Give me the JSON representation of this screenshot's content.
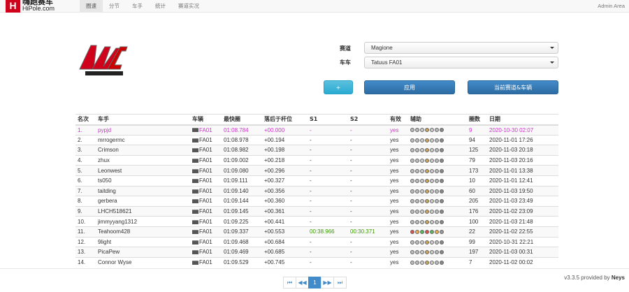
{
  "header": {
    "logo_cn": "嗨跑赛车",
    "logo_en": "HiPole.com",
    "logo_mark": "H",
    "nav": [
      "圈速",
      "分节",
      "车手",
      "统计",
      "赛道实况"
    ],
    "admin": "Admin Area"
  },
  "filters": {
    "track_label": "赛道",
    "track_value": "Magione",
    "car_label": "车车",
    "car_value": "Tatuus FA01",
    "plus_label": "+",
    "apply_label": "应用",
    "current_label": "当前赛道&车辆"
  },
  "table": {
    "headers": [
      "名次",
      "车手",
      "车辆",
      "最快圈",
      "落后于杆位",
      "S1",
      "S2",
      "有效",
      "辅助",
      "圈数",
      "日期"
    ],
    "rows": [
      {
        "rank": "1.",
        "driver": "pypjd",
        "car": "FA01",
        "best": "01:08.784",
        "gap": "+00.000",
        "s1": "-",
        "s2": "-",
        "valid": "yes",
        "laps": "9",
        "date": "2020-10-30 02:07"
      },
      {
        "rank": "2.",
        "driver": "mrrogermc",
        "car": "FA01",
        "best": "01:08.978",
        "gap": "+00.194",
        "s1": "-",
        "s2": "-",
        "valid": "yes",
        "laps": "94",
        "date": "2020-11-01 17:26"
      },
      {
        "rank": "3.",
        "driver": "Crimson",
        "car": "FA01",
        "best": "01:08.982",
        "gap": "+00.198",
        "s1": "-",
        "s2": "-",
        "valid": "yes",
        "laps": "125",
        "date": "2020-11-03 20:18"
      },
      {
        "rank": "4.",
        "driver": "zhux",
        "car": "FA01",
        "best": "01:09.002",
        "gap": "+00.218",
        "s1": "-",
        "s2": "-",
        "valid": "yes",
        "laps": "79",
        "date": "2020-11-03 20:16"
      },
      {
        "rank": "5.",
        "driver": "Leonwest",
        "car": "FA01",
        "best": "01:09.080",
        "gap": "+00.296",
        "s1": "-",
        "s2": "-",
        "valid": "yes",
        "laps": "173",
        "date": "2020-11-01 13:38"
      },
      {
        "rank": "6.",
        "driver": "ts050",
        "car": "FA01",
        "best": "01:09.111",
        "gap": "+00.327",
        "s1": "-",
        "s2": "-",
        "valid": "yes",
        "laps": "10",
        "date": "2020-11-01 12:41"
      },
      {
        "rank": "7.",
        "driver": "taitding",
        "car": "FA01",
        "best": "01:09.140",
        "gap": "+00.356",
        "s1": "-",
        "s2": "-",
        "valid": "yes",
        "laps": "60",
        "date": "2020-11-03 19:50"
      },
      {
        "rank": "8.",
        "driver": "gerbera",
        "car": "FA01",
        "best": "01:09.144",
        "gap": "+00.360",
        "s1": "-",
        "s2": "-",
        "valid": "yes",
        "laps": "205",
        "date": "2020-11-03 23:49"
      },
      {
        "rank": "9.",
        "driver": "LHCH518621",
        "car": "FA01",
        "best": "01:09.145",
        "gap": "+00.361",
        "s1": "-",
        "s2": "-",
        "valid": "yes",
        "laps": "176",
        "date": "2020-11-02 23:09"
      },
      {
        "rank": "10.",
        "driver": "jimmyyang1312",
        "car": "FA01",
        "best": "01:09.225",
        "gap": "+00.441",
        "s1": "-",
        "s2": "-",
        "valid": "yes",
        "laps": "100",
        "date": "2020-11-03 21:48"
      },
      {
        "rank": "11.",
        "driver": "Teahoom428",
        "car": "FA01",
        "best": "01:09.337",
        "gap": "+00.553",
        "s1": "00:38.966",
        "s2": "00:30.371",
        "valid": "yes",
        "laps": "22",
        "date": "2020-11-02 22:55"
      },
      {
        "rank": "12.",
        "driver": "9light",
        "car": "FA01",
        "best": "01:09.468",
        "gap": "+00.684",
        "s1": "-",
        "s2": "-",
        "valid": "yes",
        "laps": "99",
        "date": "2020-10-31 22:21"
      },
      {
        "rank": "13.",
        "driver": "PicaPew",
        "car": "FA01",
        "best": "01:09.469",
        "gap": "+00.685",
        "s1": "-",
        "s2": "-",
        "valid": "yes",
        "laps": "197",
        "date": "2020-11-03 00:31"
      },
      {
        "rank": "14.",
        "driver": "Connor Wyse",
        "car": "FA01",
        "best": "01:09.529",
        "gap": "+00.745",
        "s1": "-",
        "s2": "-",
        "valid": "yes",
        "laps": "7",
        "date": "2020-11-02 00:02"
      }
    ]
  },
  "pager": {
    "first": "⏮",
    "prev": "◀◀",
    "page": "1",
    "next": "▶▶",
    "last": "⏭"
  },
  "footer": {
    "version": "v3.3.5 provided by",
    "author": "Neys"
  },
  "colors": {
    "leader": "#cc33cc",
    "sector": "#3c9a00",
    "primary": "#428bca",
    "info": "#5bc0de",
    "brand": "#d0021b"
  }
}
